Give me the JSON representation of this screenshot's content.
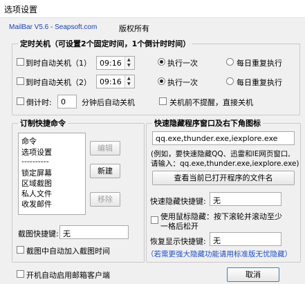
{
  "window": {
    "title": "选项设置"
  },
  "header": {
    "version": "MailBar V5.6 - Seapsoft.com",
    "copyright": "版权所有"
  },
  "timer": {
    "legend": "定时关机（可设置2个固定时间，1个倒计时时间）",
    "row1": {
      "label": "到时自动关机（1）",
      "time": "09:16",
      "option_once": "执行一次",
      "option_daily": "每日重复执行",
      "selected": "once"
    },
    "row2": {
      "label": "到时自动关机（2）",
      "time": "09:16",
      "option_once": "执行一次",
      "option_daily": "每日重复执行",
      "selected": "once"
    },
    "countdown": {
      "label": "倒计时:",
      "value": "0",
      "suffix": "分钟后自动关机"
    },
    "no_prompt": "关机前不提醒，直接关机"
  },
  "shortcuts": {
    "legend": "订制快捷命令",
    "list": [
      "命令",
      "选项设置",
      "----------",
      "锁定屏幕",
      "区域截图",
      "私人文件",
      "收发邮件"
    ],
    "edit_button": "编辑",
    "new_button": "新建",
    "remove_button": "移除",
    "screenshot_hotkey_label": "截图快捷键:",
    "screenshot_hotkey_value": "无",
    "add_time_label": "截图中自动加入截图时间"
  },
  "hide": {
    "legend": "快速隐藏程序窗口及右下角图标",
    "programs": "qq.exe,thunder.exe,iexplore.exe",
    "hint_line1": "(例如，要快速隐藏QQ、迅雷和IE网页窗口,",
    "hint_line2": "请输入：qq.exe,thunder.exe,iexplore.exe)",
    "view_button": "查看当前已打开程序的文件名",
    "hide_hotkey_label": "快速隐藏快捷键:",
    "hide_hotkey_value": "无",
    "mouse_hide_line1": "使用鼠标隐藏：按下滚轮并滚动至少",
    "mouse_hide_line2": "一格后松开",
    "restore_hotkey_label": "恢复显示快捷键:",
    "restore_hotkey_value": "无",
    "note": "（若需更强大隐藏功能请用标准版无忧隐藏）"
  },
  "footer": {
    "autostart": "开机自动启用邮箱客户端",
    "cancel": "取消"
  }
}
